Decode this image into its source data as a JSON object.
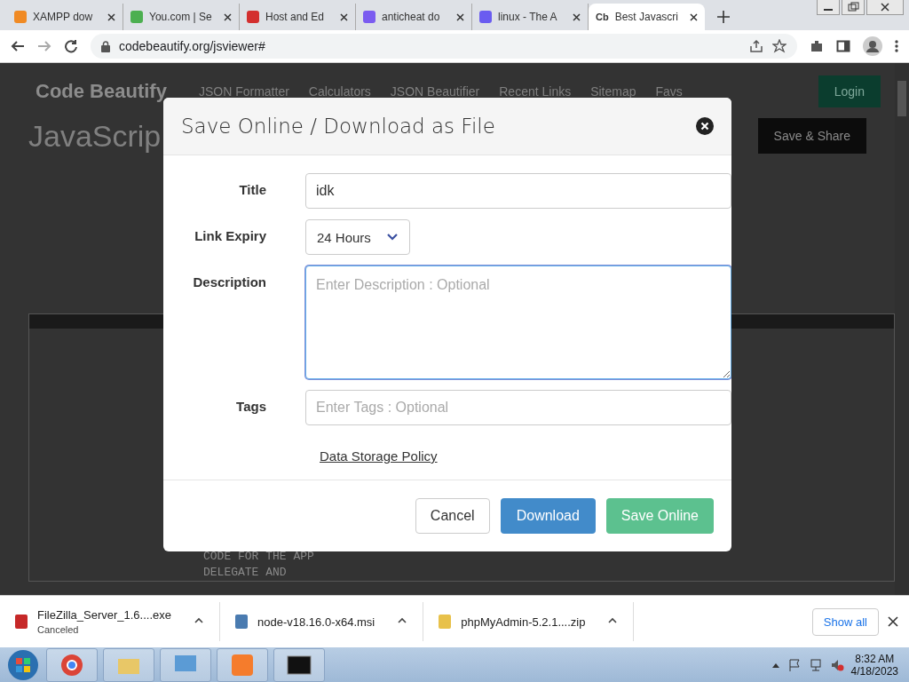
{
  "browser": {
    "tabs": [
      {
        "title": "XAMPP dow",
        "selected": false
      },
      {
        "title": "You.com | Se",
        "selected": false
      },
      {
        "title": "Host and Ed",
        "selected": false
      },
      {
        "title": "anticheat do",
        "selected": false
      },
      {
        "title": "linux - The A",
        "selected": false
      },
      {
        "title": "Best Javascri",
        "favicon_text": "Cb",
        "selected": true
      }
    ],
    "address": "codebeautify.org/jsviewer#"
  },
  "page": {
    "logo": "Code Beautify",
    "nav": [
      "JSON Formatter",
      "Calculators",
      "JSON Beautifier",
      "Recent Links",
      "Sitemap",
      "Favs"
    ],
    "login": "Login",
    "heading": "JavaScrip",
    "save_share": "Save & Share",
    "code_lines": [
      "CODE FOR THE APP",
      "DELEGATE AND"
    ]
  },
  "dialog": {
    "title": "Save Online / Download as File",
    "fields": [
      {
        "kind": "text",
        "label": "Title",
        "value": "idk",
        "focused": false
      },
      {
        "kind": "select",
        "label": "Link Expiry",
        "value": "24 Hours"
      },
      {
        "kind": "textarea",
        "label": "Description",
        "placeholder": "Enter Description : Optional",
        "focused": true
      },
      {
        "kind": "text",
        "label": "Tags",
        "placeholder": "Enter Tags : Optional",
        "focused": false
      }
    ],
    "policy_link": "Data Storage Policy",
    "buttons": [
      {
        "kind": "default",
        "label": "Cancel"
      },
      {
        "kind": "primary",
        "label": "Download"
      },
      {
        "kind": "success",
        "label": "Save Online"
      }
    ]
  },
  "downloads": {
    "items": [
      {
        "name": "FileZilla_Server_1.6....exe",
        "status": "Canceled"
      },
      {
        "name": "node-v18.16.0-x64.msi"
      },
      {
        "name": "phpMyAdmin-5.2.1....zip"
      }
    ],
    "show_all": "Show all"
  },
  "taskbar": {
    "time": "8:32 AM",
    "date": "4/18/2023"
  }
}
